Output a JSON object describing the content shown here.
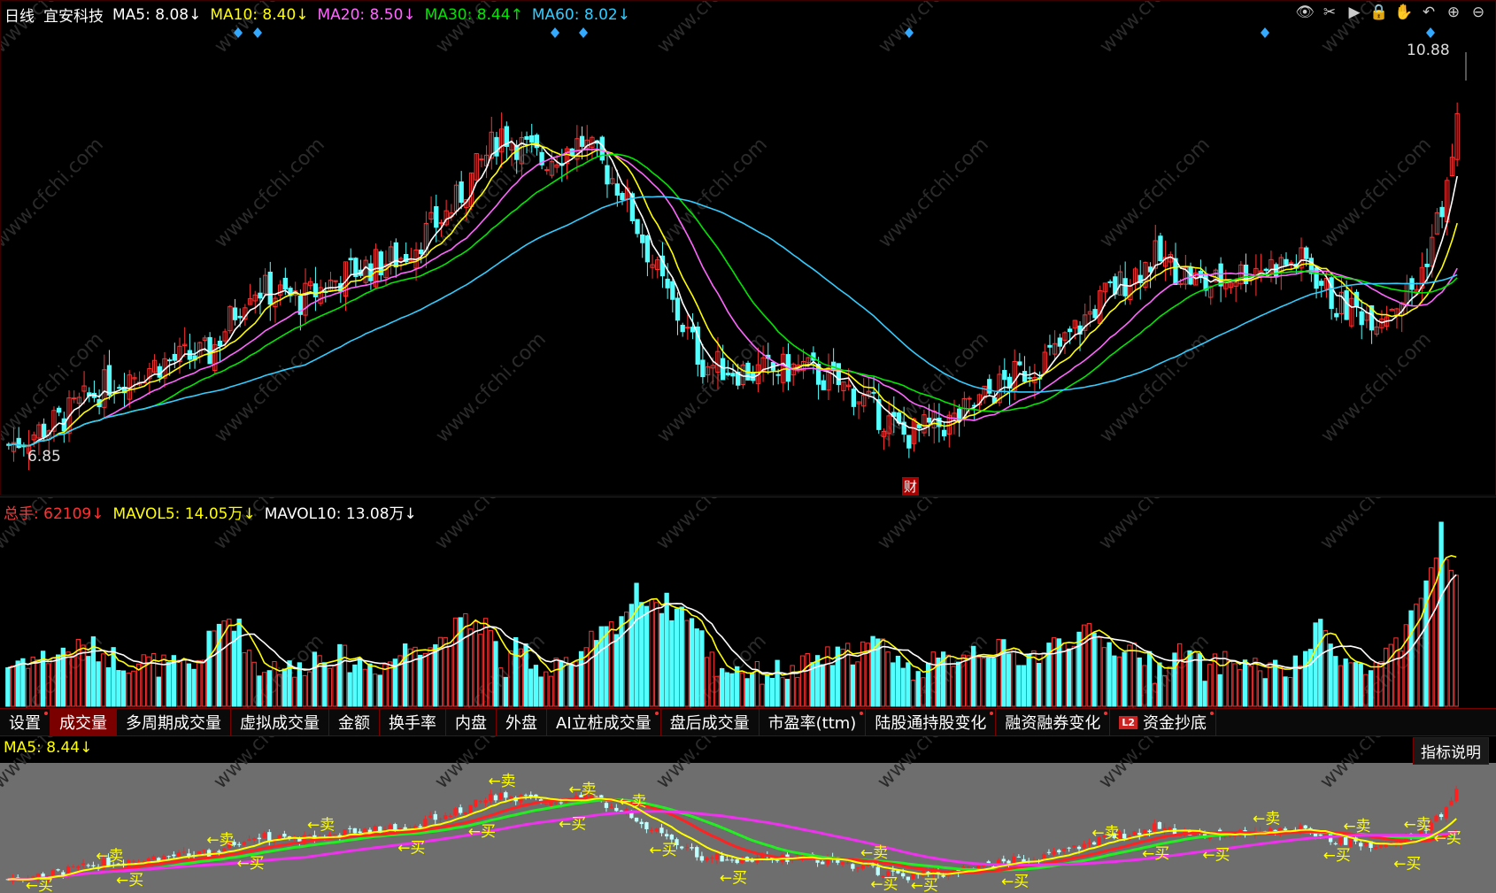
{
  "header": {
    "period": "日线",
    "stock_name": "宜安科技",
    "ma": [
      {
        "label": "MA5: 8.08↓",
        "color": "#ffffff"
      },
      {
        "label": "MA10: 8.40↓",
        "color": "#ffff00"
      },
      {
        "label": "MA20: 8.50↓",
        "color": "#ff66ff"
      },
      {
        "label": "MA30: 8.44↑",
        "color": "#00e600"
      },
      {
        "label": "MA60: 8.02↓",
        "color": "#33ccff"
      }
    ]
  },
  "toolbar_icons": [
    "eye-icon",
    "scissors-icon",
    "play-icon",
    "lock-icon",
    "hand-icon",
    "undo-icon",
    "zoom-in-icon",
    "zoom-out-icon"
  ],
  "price_panel": {
    "high_label": "10.88",
    "low_label": "6.85",
    "event_label": "财",
    "price_range": [
      6.6,
      11.1
    ]
  },
  "volume_panel": {
    "total": "总手: 62109↓",
    "mavol5": "MAVOL5: 14.05万↓",
    "mavol10": "MAVOL10: 13.08万↓"
  },
  "tabs": [
    {
      "label": "设置",
      "active": false,
      "dot": true
    },
    {
      "label": "成交量",
      "active": true,
      "dot": false
    },
    {
      "label": "多周期成交量",
      "active": false,
      "dot": false
    },
    {
      "label": "虚拟成交量",
      "active": false,
      "dot": false
    },
    {
      "label": "金额",
      "active": false,
      "dot": false
    },
    {
      "label": "换手率",
      "active": false,
      "dot": false
    },
    {
      "label": "内盘",
      "active": false,
      "dot": false
    },
    {
      "label": "外盘",
      "active": false,
      "dot": false
    },
    {
      "label": "AI立桩成交量",
      "active": false,
      "dot": true
    },
    {
      "label": "盘后成交量",
      "active": false,
      "dot": false
    },
    {
      "label": "市盈率(ttm)",
      "active": false,
      "dot": true
    },
    {
      "label": "陆股通持股变化",
      "active": false,
      "dot": true
    },
    {
      "label": "融资融券变化",
      "active": false,
      "dot": true
    },
    {
      "label": "资金抄底",
      "active": false,
      "dot": true,
      "badge": "L2"
    }
  ],
  "indicator_panel": {
    "ma5": "MA5: 8.44↓",
    "explain_button": "指标说明",
    "buy_label": "←买",
    "sell_label": "←卖"
  },
  "watermark": "www.cfchi.com",
  "colors": {
    "up": "#ff3232",
    "down": "#54ffff",
    "ma5": "#ffffff",
    "ma10": "#ffff00",
    "ma20": "#ff66ff",
    "ma30": "#00e600",
    "ma60": "#33ccff"
  }
}
